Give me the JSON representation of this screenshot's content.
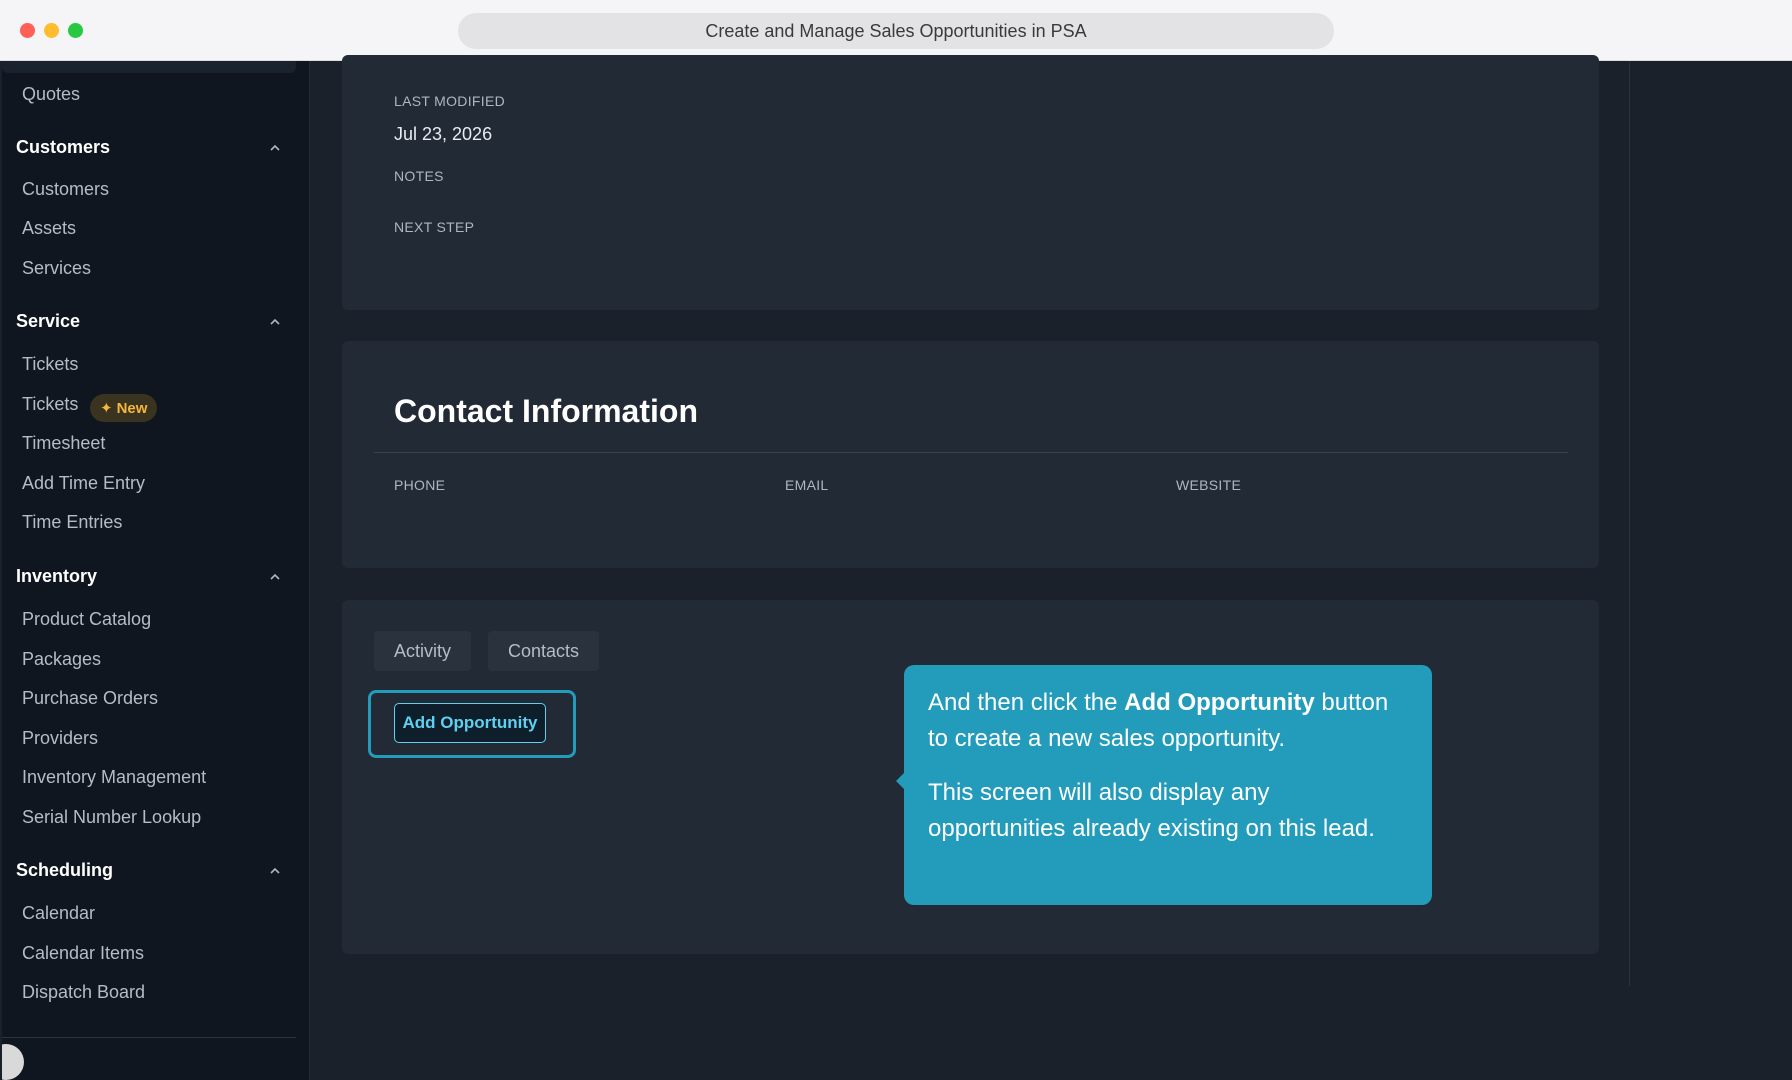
{
  "window": {
    "url_title": "Create and Manage Sales Opportunities in PSA"
  },
  "sidebar": {
    "items": {
      "quotes": "Quotes",
      "customers_section": "Customers",
      "customers": "Customers",
      "assets": "Assets",
      "services": "Services",
      "service_section": "Service",
      "tickets": "Tickets",
      "tickets_new": "Tickets",
      "new_badge": "New",
      "timesheet": "Timesheet",
      "add_time_entry": "Add Time Entry",
      "time_entries": "Time Entries",
      "inventory_section": "Inventory",
      "product_catalog": "Product Catalog",
      "packages": "Packages",
      "purchase_orders": "Purchase Orders",
      "providers": "Providers",
      "inventory_management": "Inventory Management",
      "serial_number_lookup": "Serial Number Lookup",
      "scheduling_section": "Scheduling",
      "calendar": "Calendar",
      "calendar_items": "Calendar Items",
      "dispatch_board": "Dispatch Board"
    }
  },
  "details": {
    "last_modified_label": "LAST MODIFIED",
    "last_modified_value": "Jul 23, 2026",
    "notes_label": "NOTES",
    "next_step_label": "NEXT STEP"
  },
  "contact": {
    "title": "Contact Information",
    "phone_label": "PHONE",
    "email_label": "EMAIL",
    "website_label": "WEBSITE"
  },
  "tabs": {
    "activity": "Activity",
    "contacts": "Contacts"
  },
  "actions": {
    "add_opportunity": "Add Opportunity"
  },
  "tooltip": {
    "line1_prefix": "And then click the ",
    "line1_bold": "Add Opportunity",
    "line1_suffix": " button to create a new sales opportunity.",
    "line2": "This screen will also display any opportunities already existing on this lead."
  },
  "colors": {
    "accent": "#239bbb",
    "button_text": "#5fd0ef",
    "badge": "#f5b73b"
  }
}
